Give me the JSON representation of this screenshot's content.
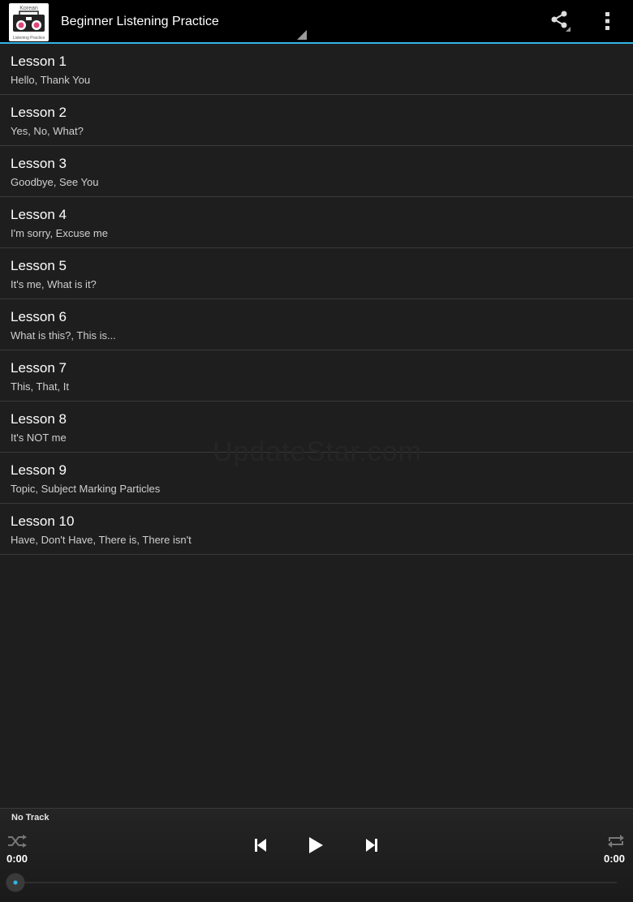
{
  "app": {
    "title": "Beginner Listening Practice",
    "icon_text_top": "Korean",
    "icon_text_bottom": "Listening Practice",
    "accent_color": "#33b5e5"
  },
  "actionbar": {
    "share_icon": "share-icon",
    "menu_icon": "overflow-menu-icon"
  },
  "lessons": [
    {
      "title": "Lesson 1",
      "subtitle": "Hello, Thank You"
    },
    {
      "title": "Lesson 2",
      "subtitle": "Yes, No, What?"
    },
    {
      "title": "Lesson 3",
      "subtitle": "Goodbye, See You"
    },
    {
      "title": "Lesson 4",
      "subtitle": "I'm sorry, Excuse me"
    },
    {
      "title": "Lesson 5",
      "subtitle": "It's me, What is it?"
    },
    {
      "title": "Lesson 6",
      "subtitle": "What is this?, This is..."
    },
    {
      "title": "Lesson 7",
      "subtitle": "This, That, It"
    },
    {
      "title": "Lesson 8",
      "subtitle": "It's NOT me"
    },
    {
      "title": "Lesson 9",
      "subtitle": "Topic, Subject Marking Particles"
    },
    {
      "title": "Lesson 10",
      "subtitle": "Have, Don't Have, There is, There isn't"
    }
  ],
  "watermark": "UpdateStar.com",
  "player": {
    "track_name": "No Track",
    "elapsed": "0:00",
    "duration": "0:00",
    "progress": 0
  }
}
